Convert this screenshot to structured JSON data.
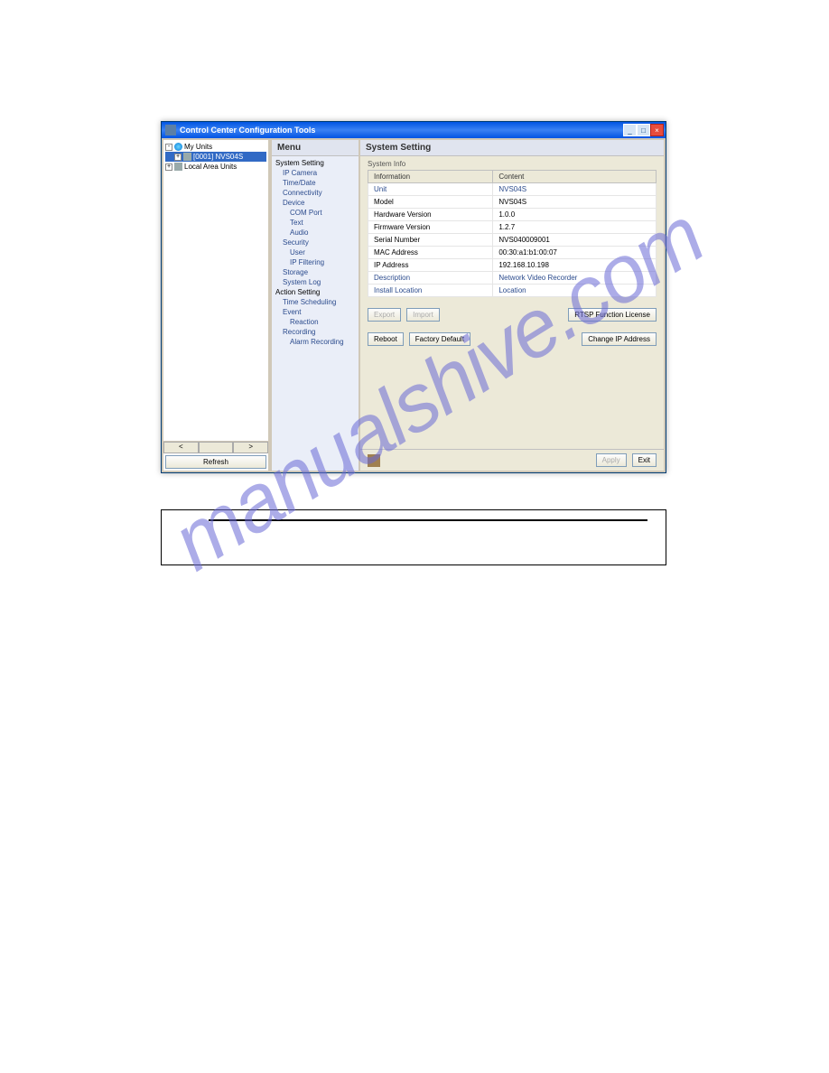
{
  "window": {
    "title": "Control Center Configuration Tools"
  },
  "tree": {
    "my_units": "My Units",
    "unit1": "[0001] NVS04S",
    "lan_units": "Local Area Units",
    "refresh": "Refresh"
  },
  "menu": {
    "head": "Menu",
    "system_setting": "System Setting",
    "ip_camera": "IP Camera",
    "time_date": "Time/Date",
    "connectivity": "Connectivity",
    "device": "Device",
    "com_port": "COM Port",
    "text": "Text",
    "audio": "Audio",
    "security": "Security",
    "user": "User",
    "ip_filtering": "IP Filtering",
    "storage": "Storage",
    "system_log": "System Log",
    "action_setting": "Action Setting",
    "time_scheduling": "Time Scheduling",
    "event": "Event",
    "reaction": "Reaction",
    "recording": "Recording",
    "alarm_recording": "Alarm Recording"
  },
  "main": {
    "head": "System Setting",
    "system_info": "System Info",
    "col_info": "Information",
    "col_content": "Content",
    "rows": [
      {
        "label": "Unit",
        "value": "NVS04S",
        "link": 1
      },
      {
        "label": "Model",
        "value": "NVS04S"
      },
      {
        "label": "Hardware Version",
        "value": "1.0.0"
      },
      {
        "label": "Firmware Version",
        "value": "1.2.7"
      },
      {
        "label": "Serial Number",
        "value": "NVS040009001"
      },
      {
        "label": "MAC Address",
        "value": "00:30:a1:b1:00:07"
      },
      {
        "label": "IP Address",
        "value": "192.168.10.198"
      },
      {
        "label": "Description",
        "value": "Network Video Recorder",
        "link": 1
      },
      {
        "label": "Install Location",
        "value": "Location",
        "link": 1
      }
    ],
    "export": "Export",
    "import": "Import",
    "rtsp": "RTSP Function License",
    "reboot": "Reboot",
    "factory_default": "Factory Default",
    "change_ip": "Change IP Address",
    "apply": "Apply",
    "exit": "Exit"
  },
  "watermark": "manualshive.com"
}
